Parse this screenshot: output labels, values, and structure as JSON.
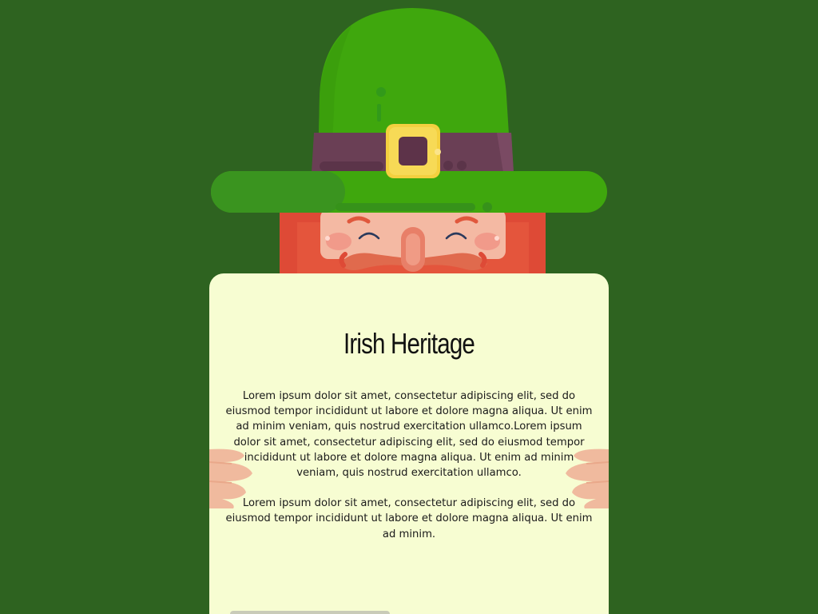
{
  "colors": {
    "background": "#2e6320",
    "hat_green": "#3fa70d",
    "hat_band": "#6a3f55",
    "buckle": "#f4d03f",
    "beard": "#de4a36",
    "face": "#f4b9a3",
    "card": "#f7fdd2"
  },
  "illustration": {
    "hat_icon": "leprechaun-hat-icon",
    "face_icon": "leprechaun-face-icon",
    "hands_icon": "leprechaun-hands-icon"
  },
  "card": {
    "title": "Irish Heritage",
    "paragraph_1": "Lorem ipsum dolor sit amet, consectetur adipiscing elit, sed do eiusmod tempor incididunt ut labore et dolore magna aliqua. Ut enim ad minim veniam, quis nostrud exercitation ullamco.Lorem ipsum dolor sit amet, consectetur adipiscing elit, sed do eiusmod tempor incididunt ut labore et dolore magna aliqua. Ut enim ad minim veniam, quis nostrud exercitation ullamco.",
    "paragraph_2": "Lorem ipsum dolor sit amet, consectetur adipiscing elit, sed do eiusmod tempor incididunt ut labore et dolore magna aliqua. Ut enim ad minim."
  }
}
